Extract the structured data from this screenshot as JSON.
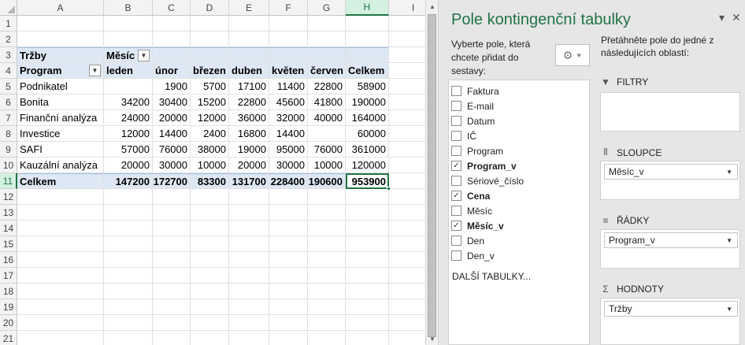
{
  "sheet": {
    "columns": [
      "A",
      "B",
      "C",
      "D",
      "E",
      "F",
      "G",
      "H",
      "I"
    ],
    "selected_column": "H",
    "rows": [
      "1",
      "2",
      "3",
      "4",
      "5",
      "6",
      "7",
      "8",
      "9",
      "10",
      "11",
      "12",
      "13",
      "14",
      "15",
      "16",
      "17",
      "18",
      "19",
      "20",
      "21"
    ],
    "selected_row": "11",
    "pivot": {
      "value_label": "Tržby",
      "column_field_label": "Měsíc",
      "row_field_label": "Program",
      "months": [
        "leden",
        "únor",
        "březen",
        "duben",
        "květen",
        "červen",
        "Celkem"
      ],
      "body": [
        {
          "label": "Podnikatel",
          "values": [
            "",
            "1900",
            "5700",
            "17100",
            "11400",
            "22800",
            "58900"
          ]
        },
        {
          "label": "Bonita",
          "values": [
            "34200",
            "30400",
            "15200",
            "22800",
            "45600",
            "41800",
            "190000"
          ]
        },
        {
          "label": "Finanční analýza",
          "values": [
            "24000",
            "20000",
            "12000",
            "36000",
            "32000",
            "40000",
            "164000"
          ]
        },
        {
          "label": "Investice",
          "values": [
            "12000",
            "14400",
            "2400",
            "16800",
            "14400",
            "",
            "60000"
          ]
        },
        {
          "label": "SAFI",
          "values": [
            "57000",
            "76000",
            "38000",
            "19000",
            "95000",
            "76000",
            "361000"
          ]
        },
        {
          "label": "Kauzální analýza",
          "values": [
            "20000",
            "30000",
            "10000",
            "20000",
            "30000",
            "10000",
            "120000"
          ]
        }
      ],
      "total": {
        "label": "Celkem",
        "values": [
          "147200",
          "172700",
          "83300",
          "131700",
          "228400",
          "190600",
          "953900"
        ]
      }
    }
  },
  "panel": {
    "title": "Pole kontingenční tabulky",
    "choose_fields_label": "Vyberte pole, která chcete přidat do sestavy:",
    "drag_label": "Přetáhněte pole do jedné z následujících oblastí:",
    "fields": [
      {
        "label": "Faktura",
        "checked": false
      },
      {
        "label": "E-mail",
        "checked": false
      },
      {
        "label": "Datum",
        "checked": false
      },
      {
        "label": "IČ",
        "checked": false
      },
      {
        "label": "Program",
        "checked": false
      },
      {
        "label": "Program_v",
        "checked": true
      },
      {
        "label": "Sériové_číslo",
        "checked": false
      },
      {
        "label": "Cena",
        "checked": true
      },
      {
        "label": "Měsíc",
        "checked": false
      },
      {
        "label": "Měsíc_v",
        "checked": true
      },
      {
        "label": "Den",
        "checked": false
      },
      {
        "label": "Den_v",
        "checked": false
      }
    ],
    "more_tables": "DALŠÍ TABULKY...",
    "areas": {
      "filters": {
        "title": "FILTRY",
        "icon": "filter-icon"
      },
      "columns": {
        "title": "SLOUPCE",
        "icon": "columns-icon",
        "item": "Měsíc_v"
      },
      "rows": {
        "title": "ŘÁDKY",
        "icon": "rows-icon",
        "item": "Program_v"
      },
      "values": {
        "title": "HODNOTY",
        "icon": "sigma-icon",
        "item": "Tržby"
      }
    }
  }
}
